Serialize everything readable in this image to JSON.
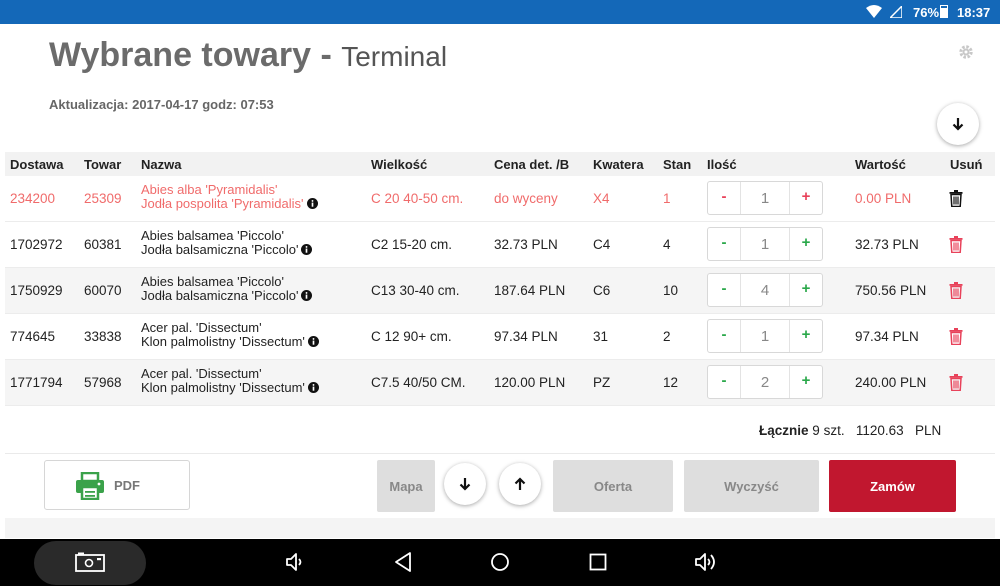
{
  "status_bar": {
    "battery": "76%",
    "time": "18:37"
  },
  "header": {
    "title": "Wybrane towary -",
    "subtitle": "Terminal",
    "update_label": "Aktualizacja: 2017-04-17 godz: 07:53"
  },
  "table": {
    "headers": [
      "Dostawa",
      "Towar",
      "Nazwa",
      "Wielkość",
      "Cena det. /B",
      "Kwatera",
      "Stan",
      "Ilość",
      "Wartość",
      "Usuń"
    ],
    "rows": [
      {
        "dostawa": "234200",
        "towar": "25309",
        "name1": "Abies alba 'Pyramidalis'",
        "name2": "Jodła pospolita 'Pyramidalis'",
        "wielkosc": "C 20 40-50 cm.",
        "cena": "do wyceny",
        "kwatera": "X4",
        "stan": "1",
        "ilosc": "1",
        "wartosc": "0.00 PLN"
      },
      {
        "dostawa": "1702972",
        "towar": "60381",
        "name1": "Abies balsamea 'Piccolo'",
        "name2": "Jodła balsamiczna 'Piccolo'",
        "wielkosc": "C2 15-20 cm.",
        "cena": "32.73 PLN",
        "kwatera": "C4",
        "stan": "4",
        "ilosc": "1",
        "wartosc": "32.73 PLN"
      },
      {
        "dostawa": "1750929",
        "towar": "60070",
        "name1": "Abies balsamea 'Piccolo'",
        "name2": "Jodła balsamiczna 'Piccolo'",
        "wielkosc": "C13 30-40 cm.",
        "cena": "187.64 PLN",
        "kwatera": "C6",
        "stan": "10",
        "ilosc": "4",
        "wartosc": "750.56 PLN"
      },
      {
        "dostawa": "774645",
        "towar": "33838",
        "name1": "Acer pal. 'Dissectum'",
        "name2": "Klon palmolistny 'Dissectum'",
        "wielkosc": "C 12 90+ cm.",
        "cena": "97.34 PLN",
        "kwatera": "31",
        "stan": "2",
        "ilosc": "1",
        "wartosc": "97.34 PLN"
      },
      {
        "dostawa": "1771794",
        "towar": "57968",
        "name1": "Acer pal. 'Dissectum'",
        "name2": "Klon palmolistny 'Dissectum'",
        "wielkosc": "C7.5 40/50 CM.",
        "cena": "120.00 PLN",
        "kwatera": "PZ",
        "stan": "12",
        "ilosc": "2",
        "wartosc": "240.00 PLN"
      }
    ],
    "qty_minus": "-",
    "qty_plus": "+"
  },
  "totals": {
    "label": "Łącznie",
    "count": "9",
    "unit": "szt.",
    "amount": "1120.63",
    "currency": "PLN"
  },
  "actions": {
    "pdf": "PDF",
    "map": "Mapa",
    "offer": "Oferta",
    "clear": "Wyczyść",
    "order": "Zamów"
  },
  "colors": {
    "status_bar": "#1468b8",
    "highlight_row": "#f06b6b",
    "order_button": "#c1172f",
    "plus_minus_green": "#2aa84a",
    "delete_red": "#e8425a"
  },
  "icons": [
    "wifi-icon",
    "sim-icon",
    "battery-icon",
    "gear-icon",
    "arrow-down-icon",
    "arrow-up-icon",
    "info-icon",
    "trash-icon",
    "printer-icon",
    "camera-icon",
    "volume-down-icon",
    "back-icon",
    "home-icon",
    "recents-icon",
    "volume-up-icon"
  ]
}
